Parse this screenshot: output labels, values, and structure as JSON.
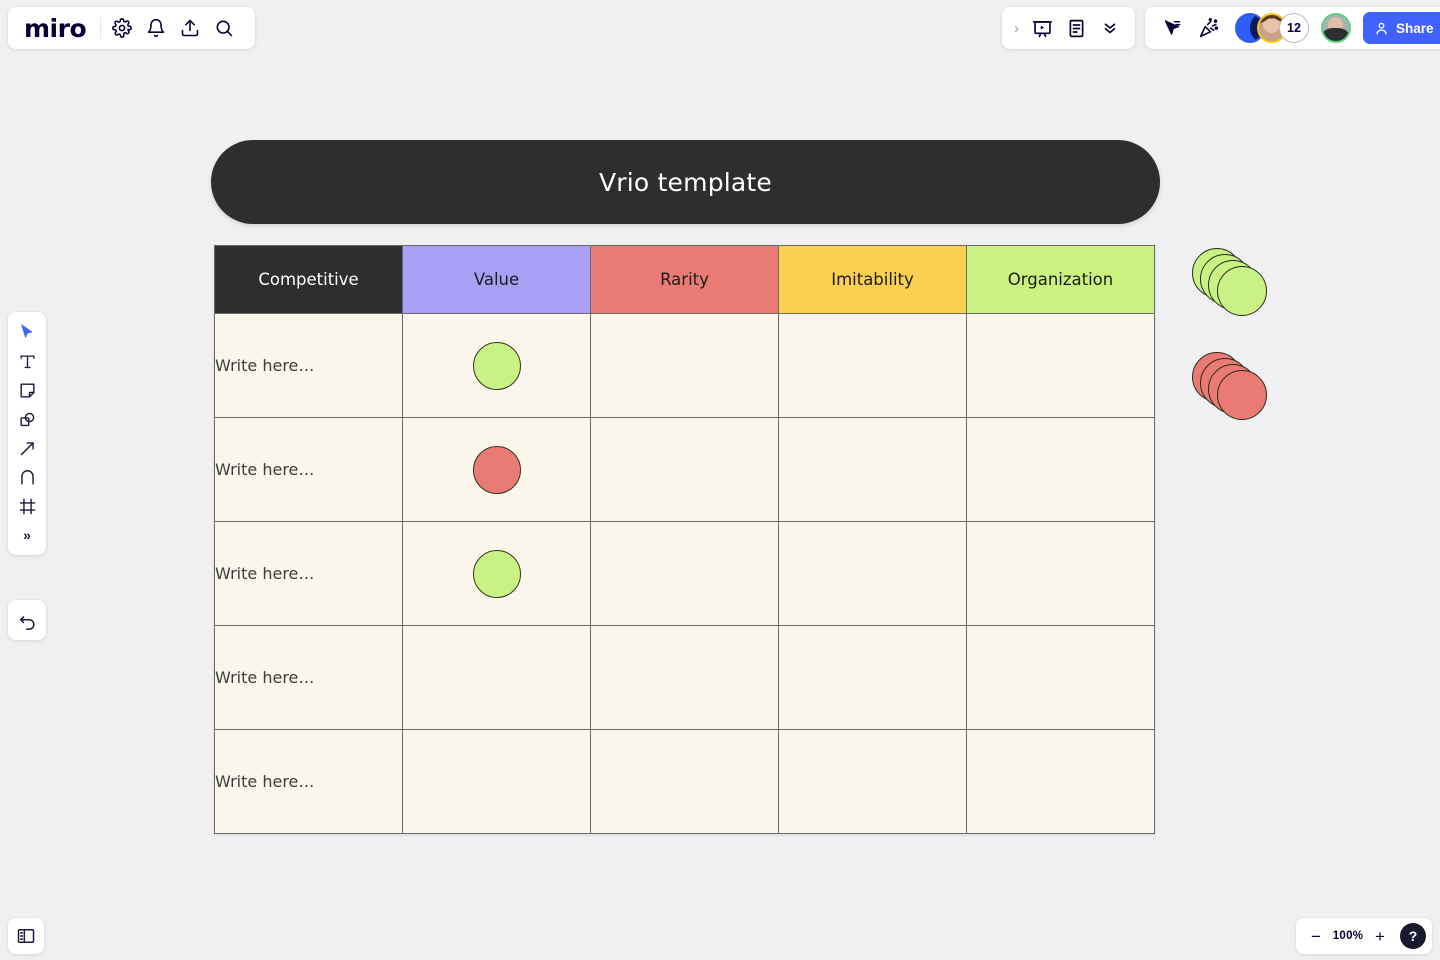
{
  "app": {
    "logo": "miro"
  },
  "topbar_left": {
    "icons": [
      {
        "name": "gear-icon",
        "label": "Settings"
      },
      {
        "name": "bell-icon",
        "label": "Notifications"
      },
      {
        "name": "upload-icon",
        "label": "Upload"
      },
      {
        "name": "search-icon",
        "label": "Search"
      }
    ]
  },
  "topbar_right": {
    "expand_chevron": "›",
    "presentation_label": "Presentation mode",
    "document_label": "Document",
    "collapse_label": "Collapse",
    "cursors_label": "Collaborator cursors",
    "celebrate_label": "Celebrate",
    "avatar_count": "12",
    "share_label": "Share"
  },
  "toolbar": {
    "tools": [
      {
        "name": "select-tool",
        "label": "Select",
        "active": true
      },
      {
        "name": "text-tool",
        "label": "Text",
        "active": false
      },
      {
        "name": "sticky-note-tool",
        "label": "Sticky note",
        "active": false
      },
      {
        "name": "shapes-tool",
        "label": "Shapes",
        "active": false
      },
      {
        "name": "connector-tool",
        "label": "Connection line",
        "active": false
      },
      {
        "name": "pen-tool",
        "label": "Pen",
        "active": false
      },
      {
        "name": "frame-tool",
        "label": "Frame",
        "active": false
      }
    ],
    "more_label": "»",
    "undo_label": "Undo"
  },
  "board": {
    "title": "Vrio template",
    "table": {
      "headers": [
        "Competitive",
        "Value",
        "Rarity",
        "Imitability",
        "Organization"
      ],
      "rows": [
        {
          "label": "Write here…",
          "marks": [
            "green",
            "",
            "",
            ""
          ]
        },
        {
          "label": "Write here…",
          "marks": [
            "red",
            "",
            "",
            ""
          ]
        },
        {
          "label": "Write here…",
          "marks": [
            "green",
            "",
            "",
            ""
          ]
        },
        {
          "label": "Write here…",
          "marks": [
            "",
            "",
            "",
            ""
          ]
        },
        {
          "label": "Write here…",
          "marks": [
            "",
            "",
            "",
            ""
          ]
        }
      ]
    },
    "sticker_stacks": [
      {
        "name": "green-dot-stack",
        "color": "green",
        "count": 4
      },
      {
        "name": "red-dot-stack",
        "color": "red",
        "count": 4
      }
    ]
  },
  "bottom": {
    "panel_toggle_label": "Toggle panel",
    "zoom_out": "−",
    "zoom_level": "100%",
    "zoom_in": "+",
    "help": "?"
  },
  "colors": {
    "canvas": "#f0f0f2",
    "dark": "#2c2e30",
    "cell": "#faf6ec",
    "value": "#a9a0f5",
    "rarity": "#ea7b74",
    "imitability": "#f9d04f",
    "organization": "#c9f27f",
    "dot_green": "#c9f284",
    "dot_red": "#ea7b74",
    "brand_blue": "#4262ff"
  }
}
